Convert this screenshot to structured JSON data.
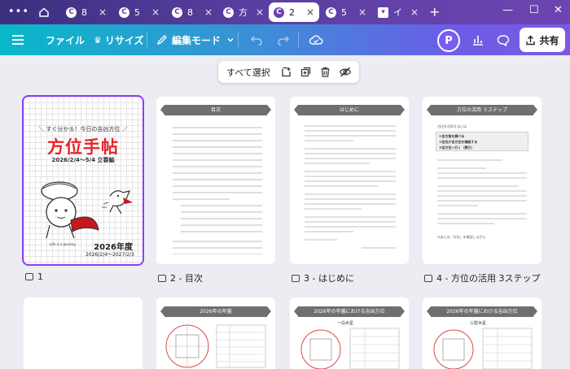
{
  "browser": {
    "more_icon": "ellipsis-icon",
    "tabs": [
      {
        "title": "8",
        "icon": "canva-icon"
      },
      {
        "title": "5",
        "icon": "canva-icon"
      },
      {
        "title": "8",
        "icon": "canva-icon"
      },
      {
        "title": "方",
        "icon": "canva-icon"
      },
      {
        "title": "2",
        "icon": "canva-icon",
        "active": true
      },
      {
        "title": "5",
        "icon": "canva-icon"
      },
      {
        "title": "イ",
        "icon": "note-icon"
      }
    ],
    "close_glyph": "×",
    "new_tab": "+"
  },
  "toolbar": {
    "file": "ファイル",
    "resize": "リサイズ",
    "edit_mode": "編集モード",
    "avatar_initial": "P",
    "share": "共有",
    "colors": {
      "gradient_start": "#08b9c9",
      "gradient_end": "#7b5ae2",
      "accent": "#8b3dff"
    }
  },
  "selection_bar": {
    "select_all": "すべて選択"
  },
  "pages": [
    {
      "label": "1"
    },
    {
      "label": "2 - 目次"
    },
    {
      "label": "3 - はじめに"
    },
    {
      "label": "4 - 方位の活用 3ステップ"
    }
  ],
  "cover": {
    "subtitle": "＼ すぐ分かる！今日の吉凶方位 ／",
    "title": "方位手帖",
    "dates": "2026/2/4〜5/4  立春編",
    "tagline": "Life is a journey.",
    "year": "2026年度",
    "range": "2026/2/4〜2027/2/3"
  },
  "toc": {
    "heading": "目次"
  },
  "intro": {
    "heading": "はじめに"
  },
  "steps": {
    "heading": "方位の活用  ３ステップ",
    "lead": "方位を活用するには",
    "box": [
      "①吉方角を調べる",
      "②吉位か吉方位を確認する",
      "③吉方位へ行く（実行）"
    ],
    "footer": "③あとは「方位」を確認しながら"
  },
  "row2": [
    {
      "heading": "2026年の年盤"
    },
    {
      "heading": "2026年の年盤における吉凶方位",
      "tag": "一白水星"
    },
    {
      "heading": "2026年の年盤における吉凶方位",
      "tag": "三碧木星"
    }
  ]
}
